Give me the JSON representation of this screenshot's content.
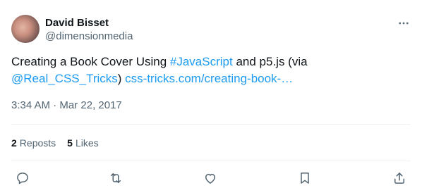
{
  "author": {
    "name": "David Bisset",
    "handle": "@dimensionmedia"
  },
  "tweet": {
    "text_before": "Creating a Book Cover Using ",
    "hashtag": "#JavaScript",
    "text_middle": " and p5.js (via ",
    "mention": "@Real_CSS_Tricks",
    "text_after": ") ",
    "url": "css-tricks.com/creating-book-…"
  },
  "meta": {
    "time": "3:34 AM",
    "separator": " · ",
    "date": "Mar 22, 2017"
  },
  "stats": {
    "reposts_count": "2",
    "reposts_label": "Reposts",
    "likes_count": "5",
    "likes_label": "Likes"
  },
  "icons": {
    "more": "more-icon",
    "reply": "reply-icon",
    "repost": "repost-icon",
    "like": "like-icon",
    "bookmark": "bookmark-icon",
    "share": "share-icon"
  },
  "colors": {
    "link": "#1d9bf0",
    "secondary_text": "#536471",
    "primary_text": "#0f1419"
  }
}
